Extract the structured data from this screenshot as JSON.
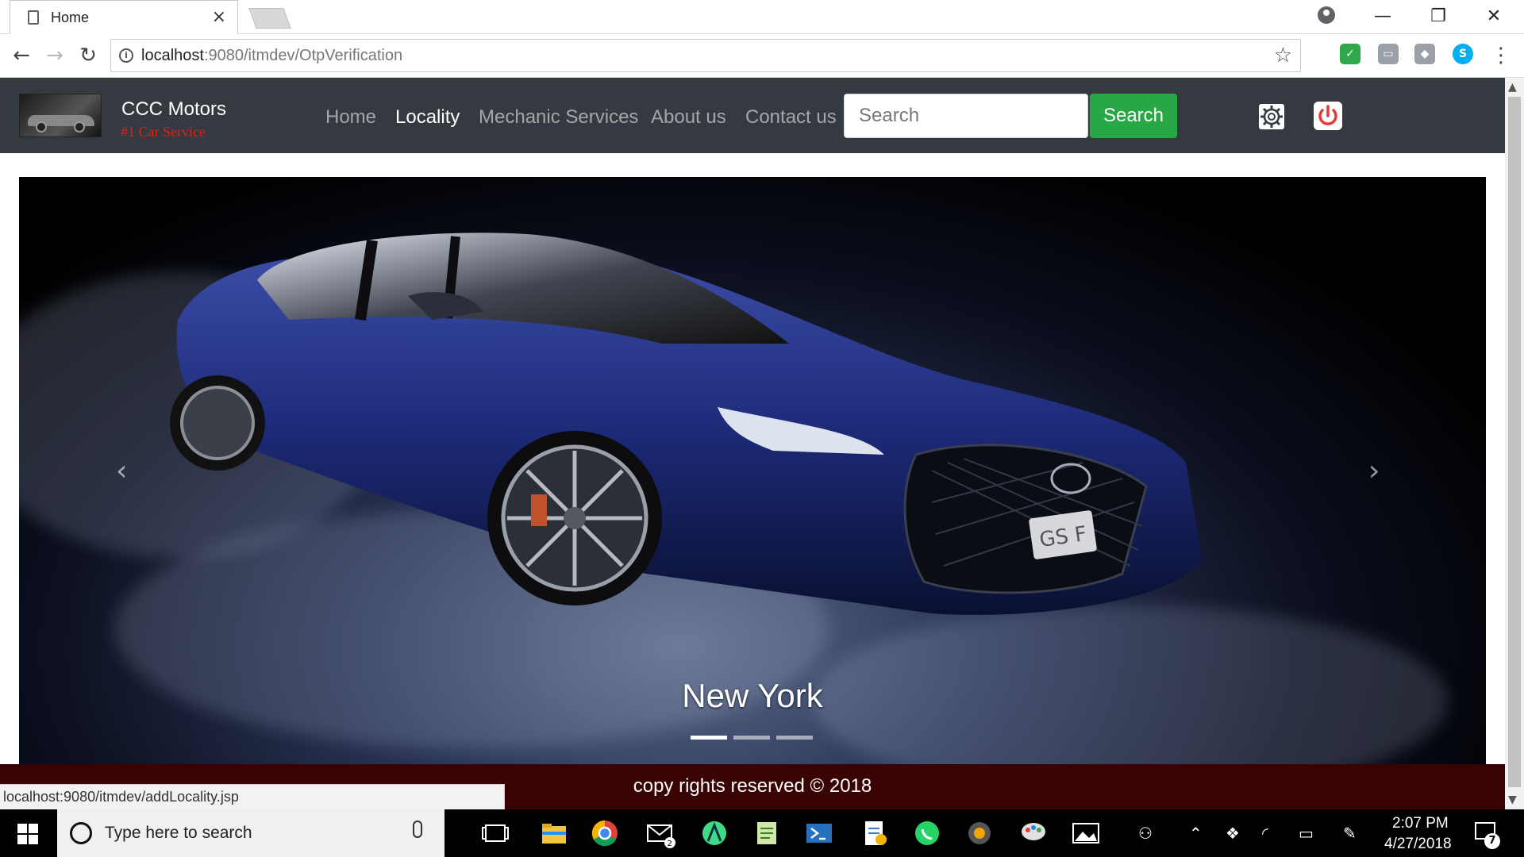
{
  "browser": {
    "tab_title": "Home",
    "tab_close": "×",
    "url_host": "localhost",
    "url_rest": ":9080/itmdev/OtpVerification",
    "status_url": "localhost:9080/itmdev/addLocality.jsp"
  },
  "site": {
    "brand_name": "CCC Motors",
    "brand_tagline": "#1 Car Service",
    "nav": [
      "Home",
      "Locality",
      "Mechanic Services",
      "About us",
      "Contact us"
    ],
    "active_nav": "Locality",
    "search_placeholder": "Search",
    "search_button": "Search",
    "accent_green": "#28a745",
    "navbar_color": "#343a40",
    "footer_color": "#3a0303"
  },
  "carousel": {
    "caption": "New York",
    "plate_text": "GS F",
    "slide_count": 3,
    "active_slide": 1
  },
  "footer": {
    "text": "copy rights reserved © 2018"
  },
  "taskbar": {
    "search_placeholder": "Type here to search",
    "mail_badge": "2",
    "time": "2:07 PM",
    "date": "4/27/2018",
    "notification_count": "7"
  }
}
